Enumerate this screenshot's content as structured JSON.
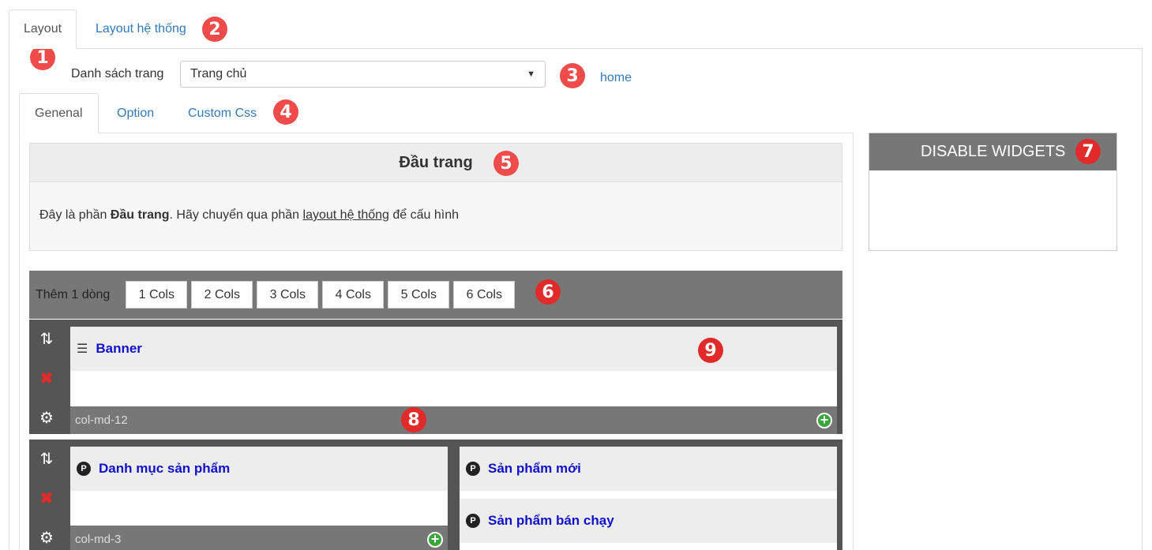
{
  "top_tabs": [
    {
      "label": "Layout",
      "active": true
    },
    {
      "label": "Layout hệ thống",
      "active": false
    }
  ],
  "page_select": {
    "label": "Danh sách trang",
    "value": "Trang chủ",
    "slug": "home"
  },
  "sub_tabs": [
    {
      "label": "Genenal",
      "active": true
    },
    {
      "label": "Option",
      "active": false
    },
    {
      "label": "Custom Css",
      "active": false
    }
  ],
  "header_section": {
    "title": "Đầu trang",
    "text_pre": "Đây là phần ",
    "text_bold": "Đầu trang",
    "text_mid": ". Hãy chuyển qua phần ",
    "text_link": "layout hệ thống",
    "text_post": " để cấu hình"
  },
  "add_row": {
    "label": "Thêm 1 dòng",
    "buttons": [
      "1 Cols",
      "2 Cols",
      "3 Cols",
      "4 Cols",
      "5 Cols",
      "6 Cols"
    ]
  },
  "disable_widgets": {
    "title": "DISABLE WIDGETS"
  },
  "rows": [
    {
      "columns": [
        {
          "class": "col-md-12",
          "widgets": [
            {
              "title": "Banner",
              "icon": "sliders-icon"
            }
          ]
        }
      ]
    },
    {
      "columns": [
        {
          "class": "col-md-3",
          "widgets": [
            {
              "title": "Danh mục sản phẩm",
              "icon": "p-icon"
            }
          ]
        },
        {
          "class": "",
          "widgets": [
            {
              "title": "Sản phẩm mới",
              "icon": "p-icon"
            },
            {
              "title": "Sản phẩm bán chạy",
              "icon": "p-icon"
            }
          ]
        }
      ]
    }
  ],
  "markers": [
    "1",
    "2",
    "3",
    "4",
    "5",
    "6",
    "7",
    "8",
    "9"
  ],
  "colors": {
    "marker": "#f04b4b",
    "link": "#337ab7",
    "widget_title": "#1111cc",
    "bar": "#777777"
  }
}
